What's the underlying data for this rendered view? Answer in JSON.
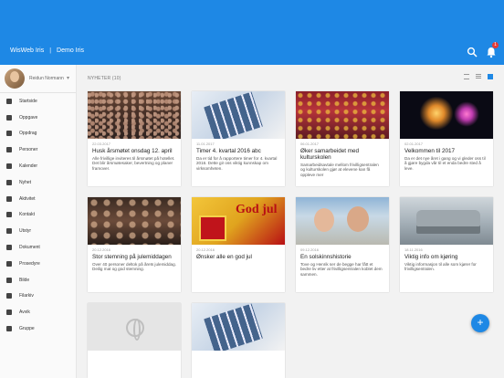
{
  "app": {
    "brand": "WisWeb Iris",
    "separator": "|",
    "context": "Demo Iris",
    "notification_count": "1"
  },
  "colors": {
    "primary": "#1e88e5",
    "badge": "#e53935"
  },
  "profile": {
    "name": "Reidun Normann",
    "icon": "chevron-down-icon"
  },
  "sidebar": {
    "items": [
      {
        "label": "Startside",
        "icon": "home-icon"
      },
      {
        "label": "Oppgave",
        "icon": "task-icon"
      },
      {
        "label": "Oppdrag",
        "icon": "checkbox-icon"
      },
      {
        "label": "Personer",
        "icon": "heart-icon"
      },
      {
        "label": "Kalender",
        "icon": "calendar-icon"
      },
      {
        "label": "Nyhet",
        "icon": "news-icon"
      },
      {
        "label": "Aktivitet",
        "icon": "activity-icon"
      },
      {
        "label": "Kontakt",
        "icon": "key-icon"
      },
      {
        "label": "Utstyr",
        "icon": "wrench-icon"
      },
      {
        "label": "Dokument",
        "icon": "document-icon"
      },
      {
        "label": "Prosedyre",
        "icon": "procedure-icon"
      },
      {
        "label": "Bilde",
        "icon": "image-icon"
      },
      {
        "label": "Filarkiv",
        "icon": "folder-icon"
      },
      {
        "label": "Avvik",
        "icon": "warning-icon"
      },
      {
        "label": "Gruppe",
        "icon": "group-icon"
      }
    ]
  },
  "main": {
    "heading": "NYHETER (10)",
    "cards": [
      {
        "date": "22.03.2017",
        "title": "Husk årsmøtet onsdag 12. april",
        "text": "Alle frivillige inviteres til årsmøtet på hotellet. Det blir årsmøtesaker, bevertning og planer framover.",
        "image": "crowd"
      },
      {
        "date": "11.01.2017",
        "title": "Timer 4. kvartal 2016 abc",
        "text": "Da er tid for å rapportere timer for 4. kvartal 2016. Dette gir oss viktig kunnskap om virksomheten.",
        "image": "calculator"
      },
      {
        "date": "06.01.2017",
        "title": "Øker samarbeidet med kulturskolen",
        "text": "Samarbeidsavtale mellom frivilligsentralen og kulturskolen gjør at elevene kan få oppleve mer",
        "image": "party"
      },
      {
        "date": "02.01.2017",
        "title": "Velkommen til 2017",
        "text": "Da er det nye året i gang og vi gleder oss til å gjøre bygda vår til et enda bedre sted å leve.",
        "image": "fireworks"
      },
      {
        "date": "20.12.2016",
        "title": "Stor stemning på julemiddagen",
        "text": "Over 40 personer deltok på årets julemiddag. Deilig mat og god stemning.",
        "image": "dinner"
      },
      {
        "date": "20.12.2016",
        "title": "Ønsker alle en god jul",
        "text": "",
        "image": "godjul",
        "image_text": "God jul"
      },
      {
        "date": "09.12.2016",
        "title": "En solskinnshistorie",
        "text": "Tove og Henrik ser de begge har fått et bedre liv etter at frivilligsentralen koblet dem sammen.",
        "image": "men"
      },
      {
        "date": "18.11.2016",
        "title": "Viktig info om kjøring",
        "text": "Viktig informasjon til alle som kjører for frivilligsentralen.",
        "image": "car"
      },
      {
        "date": "",
        "title": "",
        "text": "",
        "image": "placeholder"
      },
      {
        "date": "",
        "title": "",
        "text": "",
        "image": "calculator"
      }
    ]
  },
  "fab": {
    "label": "+"
  }
}
